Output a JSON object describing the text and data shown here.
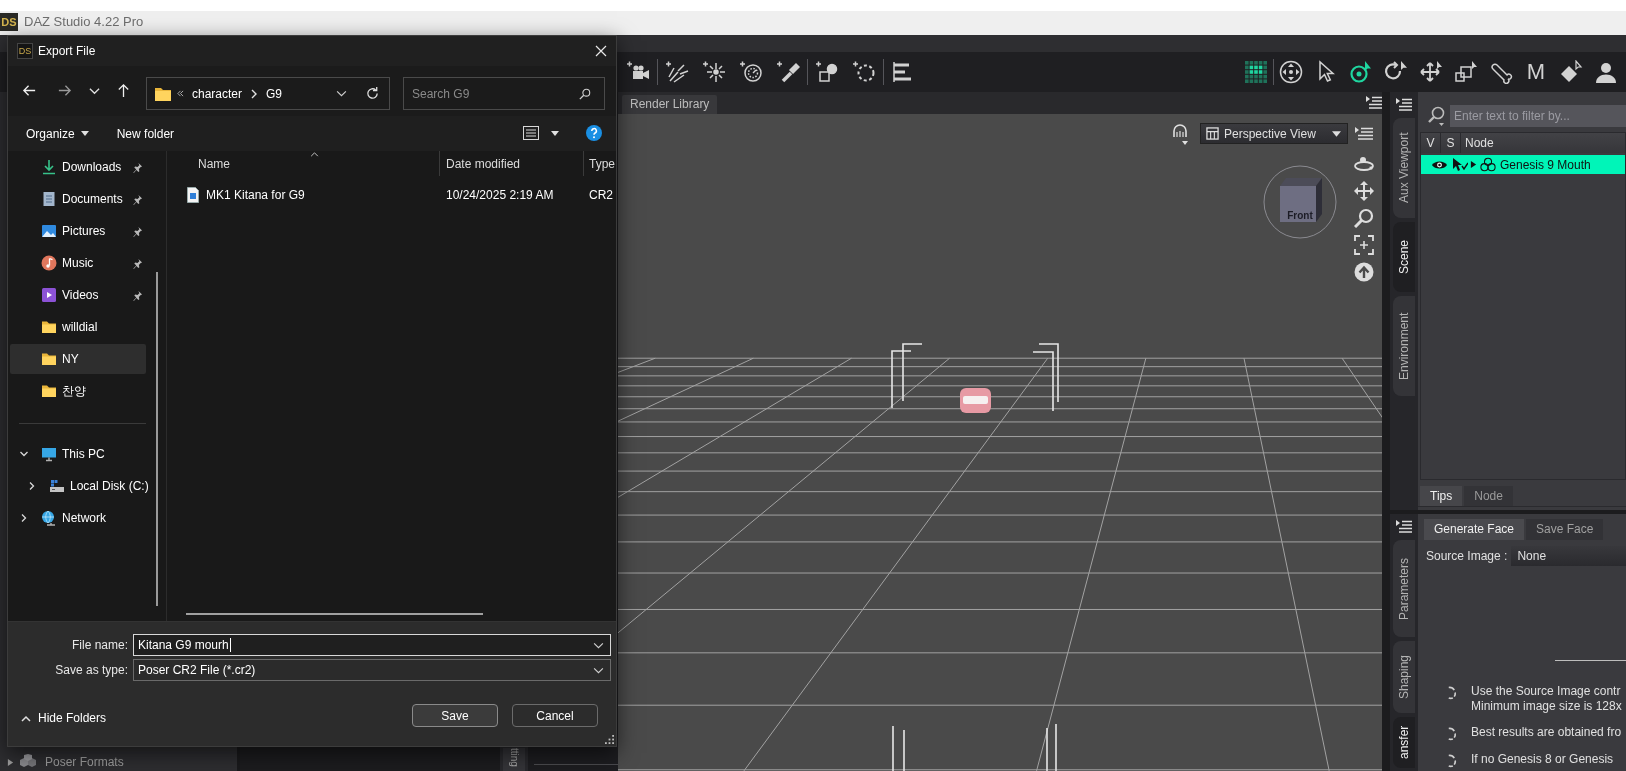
{
  "app": {
    "logo": "DS",
    "title": "DAZ Studio 4.22 Pro"
  },
  "toolbar": {
    "left_groups": [
      [
        {
          "kind": "camera"
        }
      ],
      [
        {
          "kind": "sunbeam"
        },
        {
          "kind": "burst"
        },
        {
          "kind": "dial"
        },
        {
          "kind": "flashlight"
        }
      ],
      [
        {
          "kind": "primitive"
        },
        {
          "kind": "null"
        }
      ],
      [
        {
          "kind": "align"
        }
      ]
    ],
    "right_groups": [
      [
        {
          "kind": "grid",
          "selected": true
        }
      ],
      [
        {
          "kind": "orbit",
          "selected": false
        },
        {
          "kind": "pointer",
          "selected": false
        },
        {
          "kind": "universal",
          "selected": true
        },
        {
          "kind": "rotate",
          "selected": false
        },
        {
          "kind": "move",
          "selected": false
        },
        {
          "kind": "scale",
          "selected": false
        },
        {
          "kind": "bone",
          "selected": false
        },
        {
          "kind": "morph",
          "label": "M",
          "selected": false
        },
        {
          "kind": "surface",
          "selected": false
        },
        {
          "kind": "figure",
          "selected": false
        }
      ]
    ]
  },
  "left_panel": {
    "items": [
      {
        "label": "Poser Formats",
        "expanded": false
      }
    ],
    "side_tab": "tting"
  },
  "viewport": {
    "tab": "Render Library",
    "view": "Perspective View",
    "cube_face": "Front"
  },
  "scene_panel": {
    "side_tabs": [
      {
        "label": "Aux Viewport",
        "selected": false
      },
      {
        "label": "Scene",
        "selected": true
      },
      {
        "label": "Environment",
        "selected": false
      }
    ],
    "filter_placeholder": "Enter text to filter by...",
    "columns": [
      "V",
      "S",
      "Node"
    ],
    "nodes": [
      {
        "name": "Genesis 9 Mouth",
        "visible": true,
        "selected": true,
        "expanded": false
      }
    ],
    "tabs": [
      {
        "label": "Tips",
        "selected": true
      },
      {
        "label": "Node",
        "selected": false
      }
    ]
  },
  "face_panel": {
    "side_tabs": [
      {
        "label": "Parameters",
        "selected": false
      },
      {
        "label": "Shaping",
        "selected": false
      },
      {
        "label": "ansfer",
        "selected": true
      }
    ],
    "tabs": [
      {
        "label": "Generate Face",
        "selected": true
      },
      {
        "label": "Save Face",
        "selected": false
      }
    ],
    "source_label": "Source Image :",
    "source_value": "None",
    "tips": [
      {
        "lines": [
          "Use the Source Image contr",
          "Minimum image size is 128x"
        ]
      },
      {
        "lines": [
          "Best results are obtained fro"
        ]
      },
      {
        "lines": [
          "If no Genesis 8 or Genesis"
        ]
      }
    ]
  },
  "dialog": {
    "logo": "DS",
    "title": "Export File",
    "path": [
      "character",
      "G9"
    ],
    "search_placeholder": "Search G9",
    "commands": {
      "organize": "Organize",
      "new_folder": "New folder"
    },
    "quick_access": [
      {
        "label": "Downloads",
        "kind": "downloads",
        "pinned": true,
        "selected": false
      },
      {
        "label": "Documents",
        "kind": "documents",
        "pinned": true,
        "selected": false
      },
      {
        "label": "Pictures",
        "kind": "pictures",
        "pinned": true,
        "selected": false
      },
      {
        "label": "Music",
        "kind": "music",
        "pinned": true,
        "selected": false
      },
      {
        "label": "Videos",
        "kind": "videos",
        "pinned": true,
        "selected": false
      },
      {
        "label": "willdial",
        "kind": "folder",
        "pinned": false,
        "selected": false
      },
      {
        "label": "NY",
        "kind": "folder",
        "pinned": false,
        "selected": true
      },
      {
        "label": "찬양",
        "kind": "folder",
        "pinned": false,
        "selected": false
      }
    ],
    "tree": [
      {
        "label": "This PC",
        "kind": "pc",
        "expanded": true,
        "selected": false,
        "children": [
          {
            "label": "Local Disk (C:)",
            "kind": "disk",
            "expanded": false,
            "selected": false
          }
        ]
      },
      {
        "label": "Network",
        "kind": "network",
        "expanded": false,
        "selected": false
      }
    ],
    "columns": [
      {
        "label": "Name",
        "sorted": true
      },
      {
        "label": "Date modified",
        "sorted": false
      },
      {
        "label": "Type",
        "sorted": false
      }
    ],
    "files": [
      {
        "name": "MK1 Kitana for G9",
        "date_modified": "10/24/2025 2:19 AM",
        "type": "CR2"
      }
    ],
    "file_name": {
      "label": "File name:",
      "value": "Kitana G9 mourh"
    },
    "save_as_type": {
      "label": "Save as type:",
      "value": "Poser CR2 File (*.cr2)"
    },
    "hide_folders": "Hide Folders",
    "buttons": [
      {
        "label": "Save",
        "default": true
      },
      {
        "label": "Cancel",
        "default": false
      }
    ]
  }
}
